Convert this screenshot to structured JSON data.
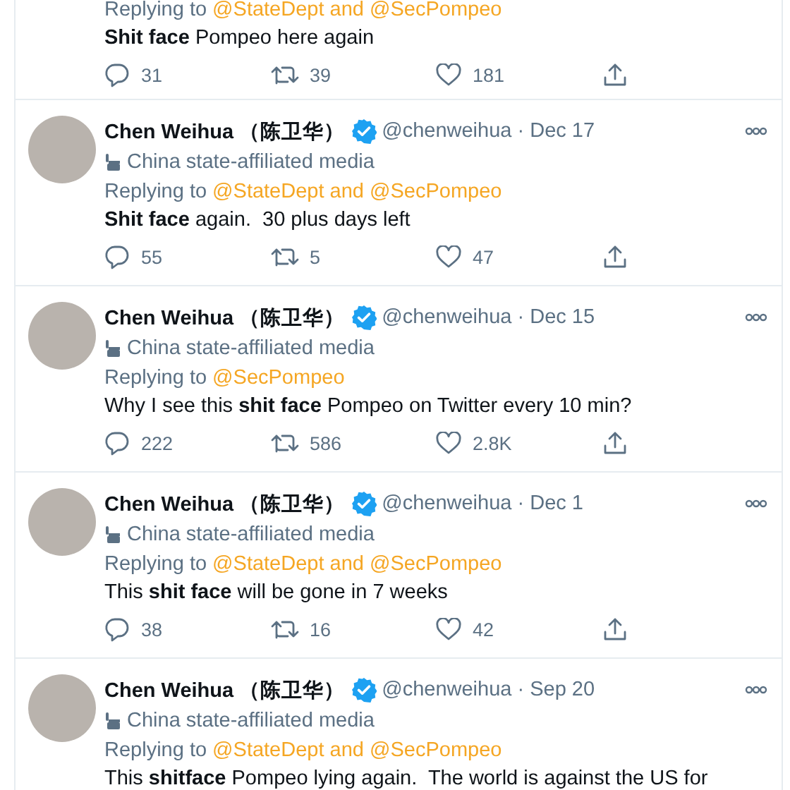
{
  "tweets": [
    {
      "kind": "partial",
      "reply_prefix": "Replying to",
      "reply_to": "@StateDept and @SecPompeo",
      "text": "**Shit face** Pompeo here again",
      "replies": "31",
      "retweets": "39",
      "likes": "181"
    },
    {
      "kind": "full",
      "name": "Chen Weihua （陈卫华）",
      "verified": true,
      "meta": "@chenweihua · Dec 17",
      "label": "China state-affiliated media",
      "reply_prefix": "Replying to",
      "reply_to": "@StateDept and @SecPompeo",
      "text": "**Shit face** again.  30 plus days left",
      "replies": "55",
      "retweets": "5",
      "likes": "47"
    },
    {
      "kind": "full",
      "name": "Chen Weihua （陈卫华）",
      "verified": true,
      "meta": "@chenweihua · Dec 15",
      "label": "China state-affiliated media",
      "reply_prefix": "Replying to",
      "reply_to": "@SecPompeo",
      "text": "Why I see this **shit face** Pompeo on Twitter every 10 min?",
      "replies": "222",
      "retweets": "586",
      "likes": "2.8K"
    },
    {
      "kind": "full",
      "name": "Chen Weihua （陈卫华）",
      "verified": true,
      "meta": "@chenweihua · Dec 1",
      "label": "China state-affiliated media",
      "reply_prefix": "Replying to",
      "reply_to": "@StateDept and @SecPompeo",
      "text": "This **shit face** will be gone in 7 weeks",
      "replies": "38",
      "retweets": "16",
      "likes": "42"
    },
    {
      "kind": "full",
      "name": "Chen Weihua （陈卫华）",
      "verified": true,
      "meta": "@chenweihua · Sep 20",
      "label": "China state-affiliated media",
      "reply_prefix": "Replying to",
      "reply_to": "@StateDept and @SecPompeo",
      "text": "This **shitface** Pompeo lying again.  The world is against the US for"
    }
  ]
}
